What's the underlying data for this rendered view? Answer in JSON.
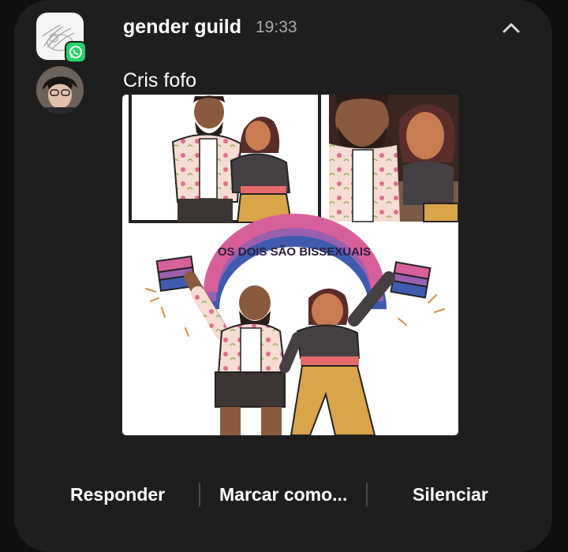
{
  "notification": {
    "group_title": "gender guild",
    "time": "19:33",
    "sender": "Cris fofo",
    "app_badge_icon": "whatsapp-icon",
    "collapse_icon": "chevron-up-icon"
  },
  "image": {
    "banner_text": "OS DOIS SÃO BISSEXUAIS"
  },
  "actions": {
    "reply": "Responder",
    "mark": "Marcar como...",
    "mute": "Silenciar"
  },
  "colors": {
    "card": "#1e1e1e",
    "whatsapp": "#25d366",
    "bi_pink": "#d8609a",
    "bi_purple": "#9b5fb0",
    "bi_blue": "#3f5bb0"
  }
}
